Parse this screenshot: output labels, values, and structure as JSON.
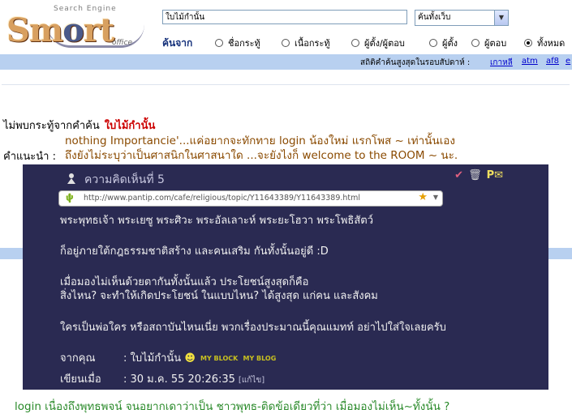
{
  "logo": {
    "brand_s": "S",
    "brand_m": "m",
    "brand_o": "o",
    "brand_rest": "rt",
    "tag_top": "Search Engine",
    "tag_bottom": "office"
  },
  "search": {
    "query": "ใบไม้กำนั้น",
    "scope": "ค้นทั้งเว็บ",
    "from_label": "ค้นจาก",
    "options": [
      "ชื่อกระทู้",
      "เนื้อกระทู้",
      "ผู้ตั้ง/ผู้ตอบ",
      "ผู้ตั้ง",
      "ผู้ตอบ",
      "ทั้งหมด"
    ],
    "selected_option": "ทั้งหมด"
  },
  "stats": {
    "label": "สถิติคำค้นสูงสุดในรอบสัปดาห์ :",
    "links": [
      "เกาหลี",
      "atm",
      "af8",
      "e"
    ]
  },
  "results": {
    "not_found_prefix": "ไม่พบกระทู้จากคำค้น",
    "not_found_query": "ใบไม้กำนั้น",
    "suggest_label": "คำแนะนำ :",
    "overlay_line1": "nothing Importancie'...แค่อยากจะทักทาย login น้องใหม่ แรกโพส ~ เท่านั้นเอง",
    "overlay_line2": "ถึงยังไม่ระบุว่าเป็นศาสนิกในศาสนาใด ...จะยังไงก็ welcome to the ROOM ~ นะ."
  },
  "comment": {
    "header": "ความคิดเห็นที่ 5",
    "url": "http://www.pantip.com/cafe/religious/topic/Y11643389/Y11643389.html",
    "lines": [
      "พระพุทธเจ้า พระเยซู พระศิวะ พระอัลเลาะห์ พระยะโฮวา พระโพธิสัตว์",
      "ก็อยู่ภายใต้กฎธรรมชาติสร้าง และคนเสริม กันทั้งนั้นอยู่ดี :D",
      "เมื่อมองไม่เห็นด้วยตากันทั้งนั้นแล้ว ประโยชน์สูงสุดก็คือ",
      "สิ่งไหน? จะทำให้เกิดประโยชน์ ในแบบไหน? ได้สูงสุด แก่คน และสังคม",
      "ใครเป็นพ่อใคร หรือสถาบันไหนเนี่ย พวกเรื่องประมาณนี้คุณแมทท์ อย่าไปใส่ใจเลยครับ"
    ],
    "from_label": "จากคุณ",
    "from_value": ": ใบไม้กำนั้น",
    "badge_block": "MY BLOCK",
    "badge_blog": "MY BLOG",
    "written_label": "เขียนเมื่อ",
    "written_value": ": 30 ม.ค. 55 20:26:35",
    "edit_label": "[แก้ไข]"
  },
  "footer_line": "login เนื่องถึงพุทธพจน์ จนอยากเดาว่าเป็น ชาวพุทธ-ติดข้อเดียวที่ว่า เมื่อมองไม่เห็น~ทั้งนั้น ?"
}
